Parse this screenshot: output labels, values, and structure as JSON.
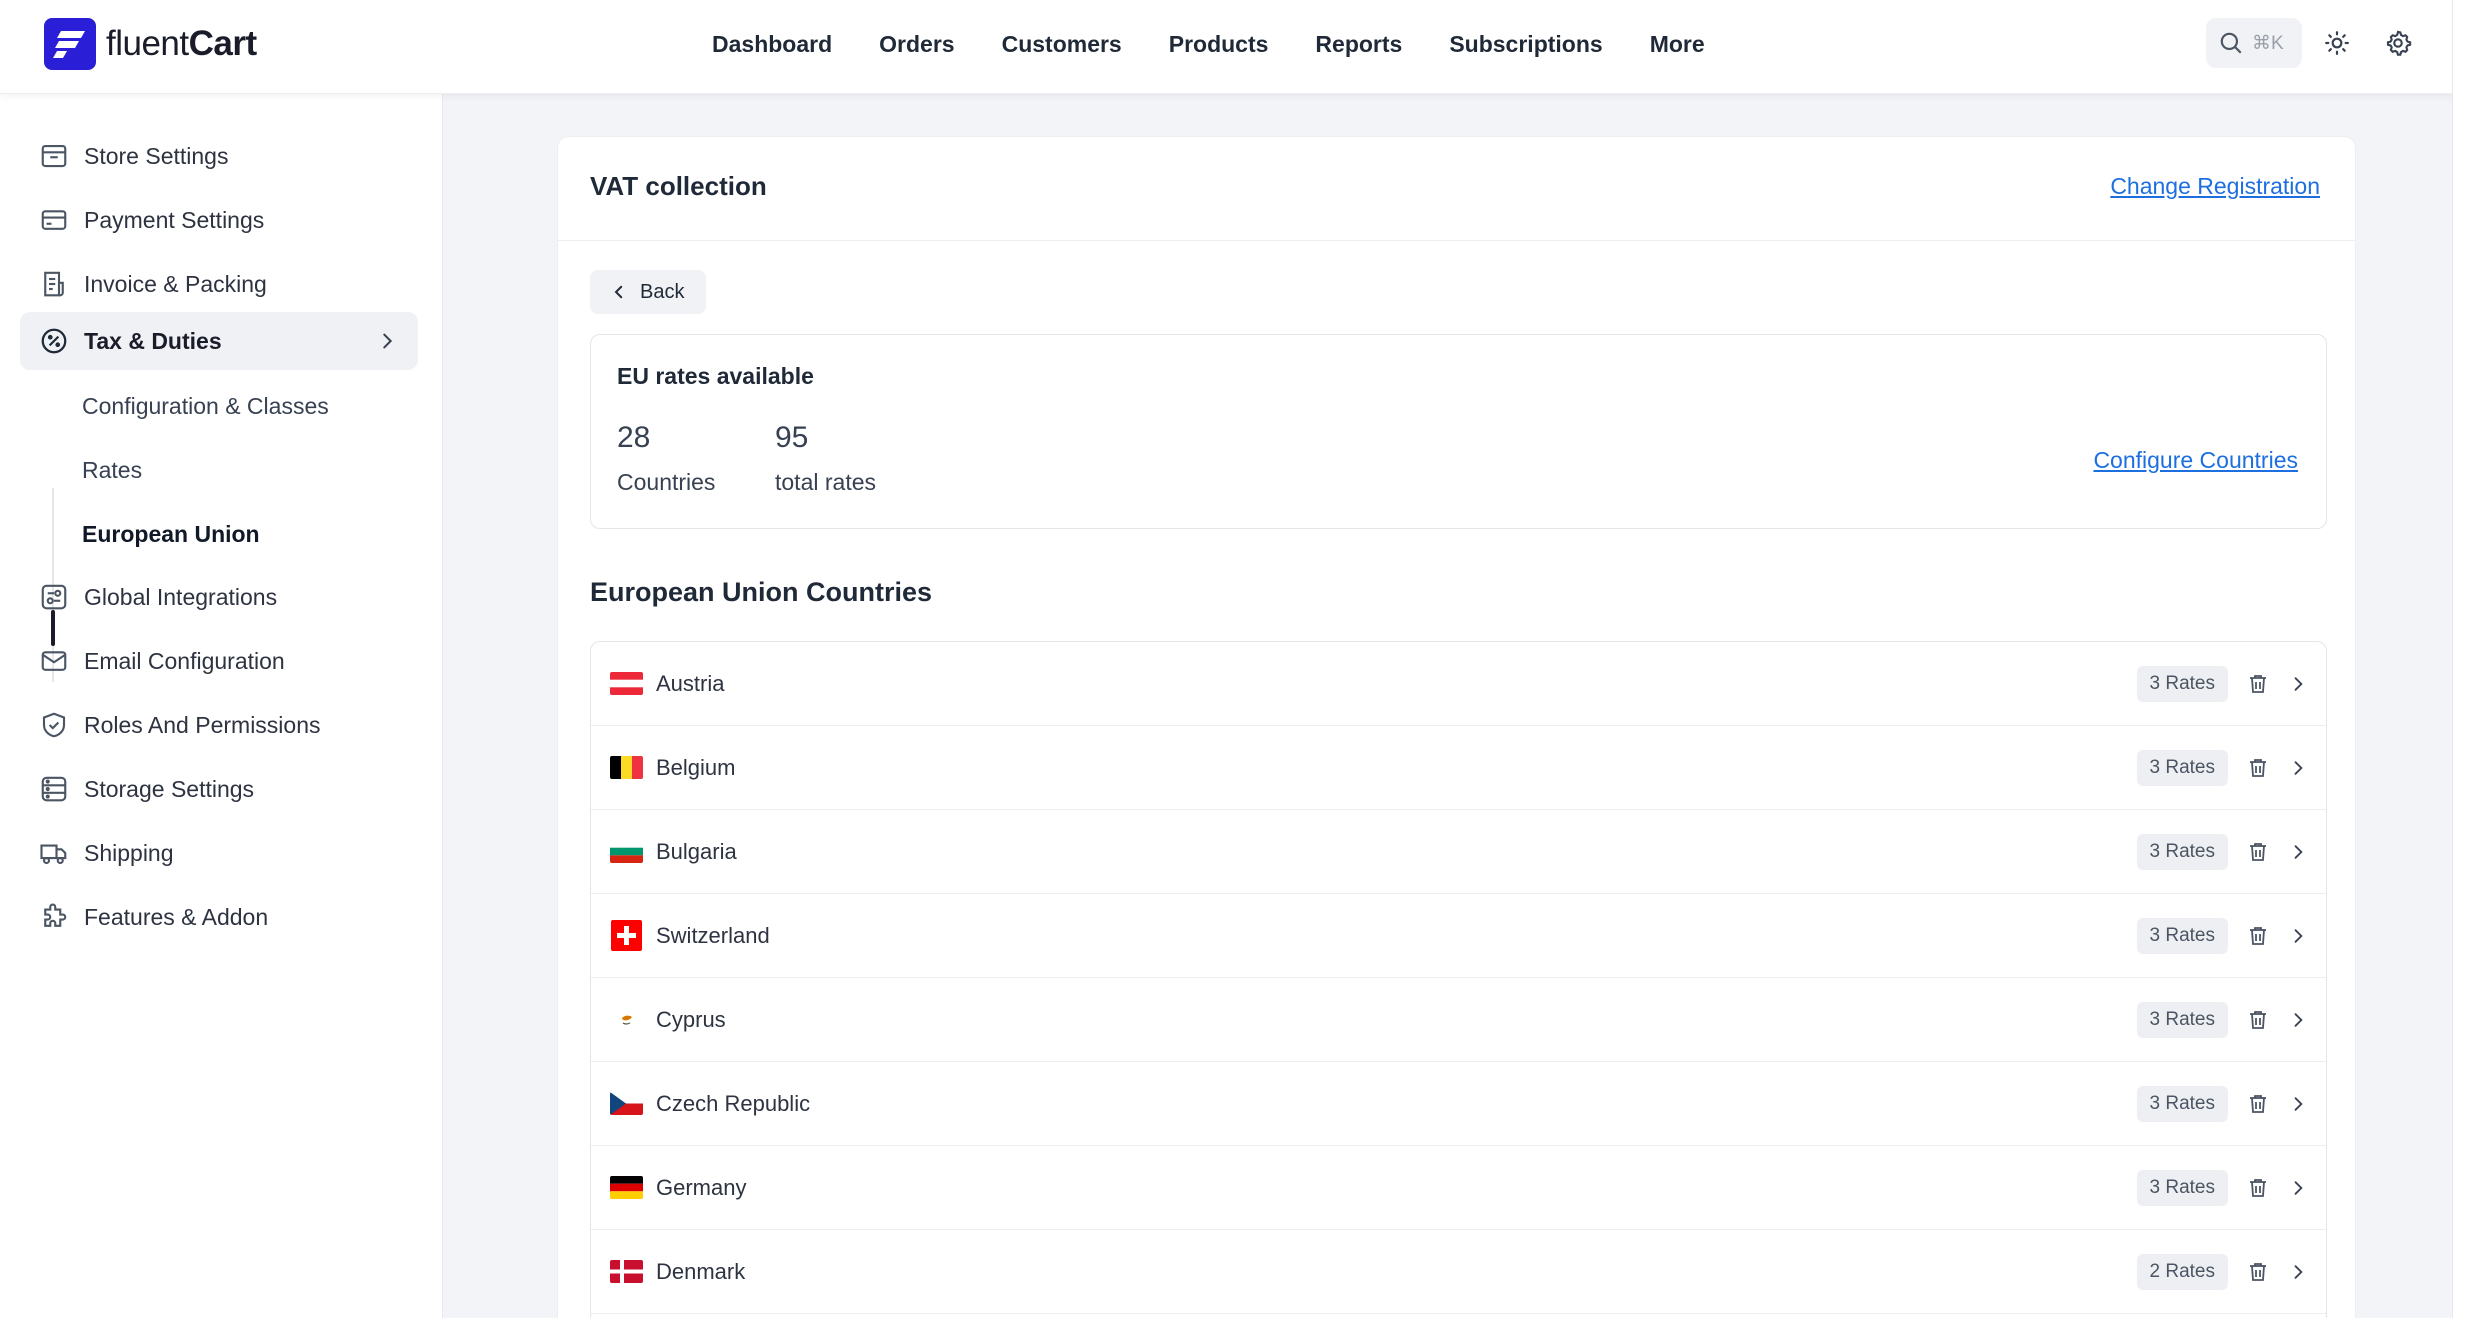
{
  "brand": {
    "name_light": "fluent",
    "name_bold": "Cart",
    "accent": "#2a1fd6"
  },
  "topnav": {
    "items": [
      "Dashboard",
      "Orders",
      "Customers",
      "Products",
      "Reports",
      "Subscriptions",
      "More"
    ],
    "search_shortcut": "⌘K"
  },
  "sidebar": {
    "items": [
      {
        "label": "Store Settings",
        "icon": "store-icon"
      },
      {
        "label": "Payment Settings",
        "icon": "credit-card-icon"
      },
      {
        "label": "Invoice & Packing",
        "icon": "invoice-icon"
      },
      {
        "label": "Tax & Duties",
        "icon": "percent-icon"
      },
      {
        "label": "Global Integrations",
        "icon": "integrations-icon"
      },
      {
        "label": "Email Configuration",
        "icon": "mail-icon"
      },
      {
        "label": "Roles And Permissions",
        "icon": "shield-check-icon"
      },
      {
        "label": "Storage Settings",
        "icon": "storage-icon"
      },
      {
        "label": "Shipping",
        "icon": "truck-icon"
      },
      {
        "label": "Features & Addon",
        "icon": "puzzle-icon"
      }
    ],
    "tax_sub_items": [
      "Configuration & Classes",
      "Rates",
      "European Union"
    ],
    "active_item": "Tax & Duties",
    "active_sub_item": "European Union"
  },
  "main": {
    "title": "VAT collection",
    "change_registration": "Change Registration",
    "back_label": "Back",
    "stats": {
      "title": "EU rates available",
      "countries_count": "28",
      "countries_label": "Countries",
      "rates_count": "95",
      "rates_label": "total rates",
      "configure_label": "Configure Countries"
    },
    "section_title": "European Union Countries",
    "countries": [
      {
        "name": "Austria",
        "rates": "3 Rates",
        "flag": "flag-austria"
      },
      {
        "name": "Belgium",
        "rates": "3 Rates",
        "flag": "flag-belgium"
      },
      {
        "name": "Bulgaria",
        "rates": "3 Rates",
        "flag": "flag-bulgaria"
      },
      {
        "name": "Switzerland",
        "rates": "3 Rates",
        "flag": "flag-switzerland"
      },
      {
        "name": "Cyprus",
        "rates": "3 Rates",
        "flag": "flag-cyprus"
      },
      {
        "name": "Czech Republic",
        "rates": "3 Rates",
        "flag": "flag-czech-republic"
      },
      {
        "name": "Germany",
        "rates": "3 Rates",
        "flag": "flag-germany"
      },
      {
        "name": "Denmark",
        "rates": "2 Rates",
        "flag": "flag-denmark"
      }
    ]
  },
  "colors": {
    "link": "#1d6fe0",
    "active_bg": "#f0f1f4"
  }
}
